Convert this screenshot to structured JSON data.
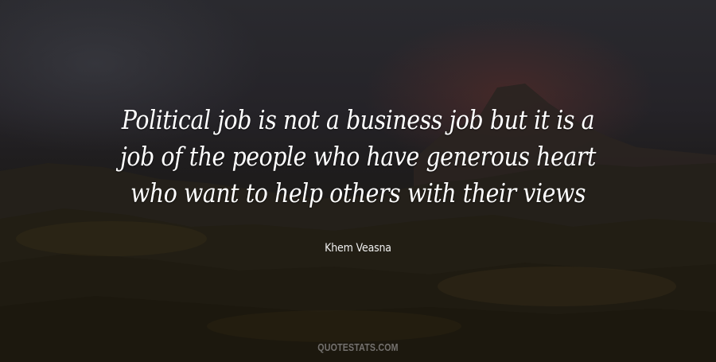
{
  "quote": {
    "lines": [
      "Political job is not a business job but it is a",
      "job of the people who have generous heart",
      "who want to help others with their views"
    ],
    "author": "Khem Veasna"
  },
  "watermark": "QUOTESTATS.COM",
  "colors": {
    "text": "#ffffff",
    "background": "#1e1c1d",
    "watermark": "#8a8887"
  }
}
